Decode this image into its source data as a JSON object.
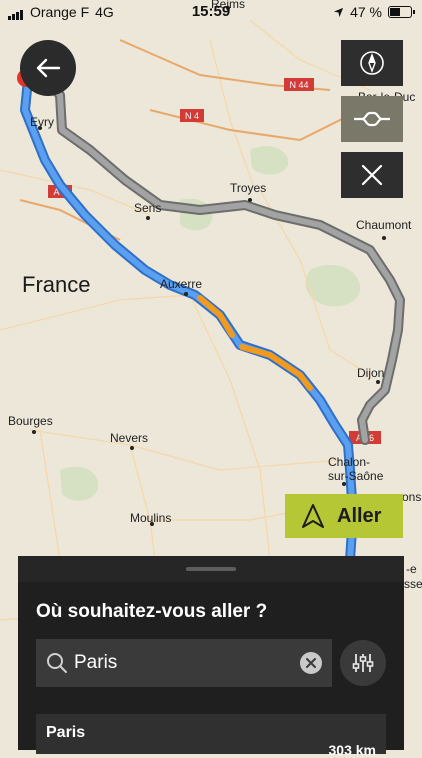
{
  "status": {
    "carrier": "Orange F",
    "network": "4G",
    "time": "15:59",
    "battery": "47 %"
  },
  "map": {
    "country_label": "France",
    "cities": {
      "reims": "Reims",
      "evry": "Evry",
      "sens": "Sens",
      "troyes": "Troyes",
      "chaumont": "Chaumont",
      "auxerre": "Auxerre",
      "dijon": "Dijon",
      "bourges": "Bourges",
      "nevers": "Nevers",
      "moulins": "Moulins",
      "chalon1": "Chalon-",
      "chalon2": "sur-Saône",
      "barleduc": "Bar-le-Duc",
      "edge_ons": "ons",
      "edge_e": "-e",
      "edge_sse": "sse"
    },
    "roads": {
      "n44": "N 44",
      "n4": "N 4",
      "a6": "A 6",
      "a36": "A 36"
    }
  },
  "buttons": {
    "go_label": "Aller"
  },
  "sheet": {
    "title": "Où souhaitez-vous aller ?",
    "search_value": "Paris",
    "result_name": "Paris",
    "result_distance": "303 km"
  },
  "colors": {
    "route_main": "#4a8fe3",
    "route_alt": "#8f8f8f",
    "traffic": "#f29a1e",
    "go_button": "#b5c734"
  }
}
